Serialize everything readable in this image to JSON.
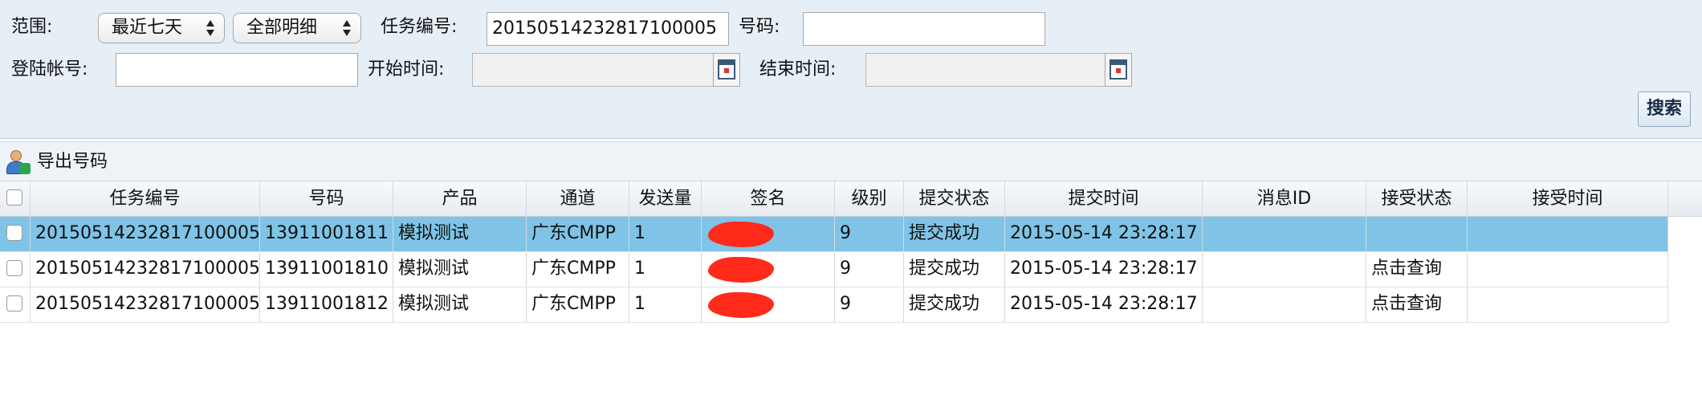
{
  "filters": {
    "range_label": "范围:",
    "range_select": "最近七天",
    "detail_select": "全部明细",
    "task_id_label": "任务编号:",
    "task_id_value": "20150514232817100005",
    "number_label": "号码:",
    "number_value": "",
    "login_label": "登陆帐号:",
    "login_value": "",
    "start_time_label": "开始时间:",
    "start_time_value": "",
    "end_time_label": "结束时间:",
    "end_time_value": "",
    "search_button": "搜索"
  },
  "toolbar": {
    "export_label": "导出号码",
    "export_icon": "user-export-icon"
  },
  "table": {
    "columns": [
      "任务编号",
      "号码",
      "产品",
      "通道",
      "发送量",
      "签名",
      "级别",
      "提交状态",
      "提交时间",
      "消息ID",
      "接受状态",
      "接受时间"
    ],
    "rows": [
      {
        "task_id": "20150514232817100005",
        "number": "13911001811",
        "product": "模拟测试",
        "channel": "广东CMPP",
        "count": "1",
        "signature": "",
        "level": "9",
        "submit_status": "提交成功",
        "submit_time": "2015-05-14 23:28:17",
        "msg_id": "",
        "recv_status": "",
        "recv_time": "",
        "selected": true
      },
      {
        "task_id": "20150514232817100005",
        "number": "13911001810",
        "product": "模拟测试",
        "channel": "广东CMPP",
        "count": "1",
        "signature": "",
        "level": "9",
        "submit_status": "提交成功",
        "submit_time": "2015-05-14 23:28:17",
        "msg_id": "",
        "recv_status": "点击查询",
        "recv_time": "",
        "selected": false
      },
      {
        "task_id": "20150514232817100005",
        "number": "13911001812",
        "product": "模拟测试",
        "channel": "广东CMPP",
        "count": "1",
        "signature": "",
        "level": "9",
        "submit_status": "提交成功",
        "submit_time": "2015-05-14 23:28:17",
        "msg_id": "",
        "recv_status": "点击查询",
        "recv_time": "",
        "selected": false
      }
    ]
  },
  "colors": {
    "panel_bg": "#e6eef6",
    "selected_row": "#7fc4e6",
    "redaction": "#ff2a1a"
  }
}
